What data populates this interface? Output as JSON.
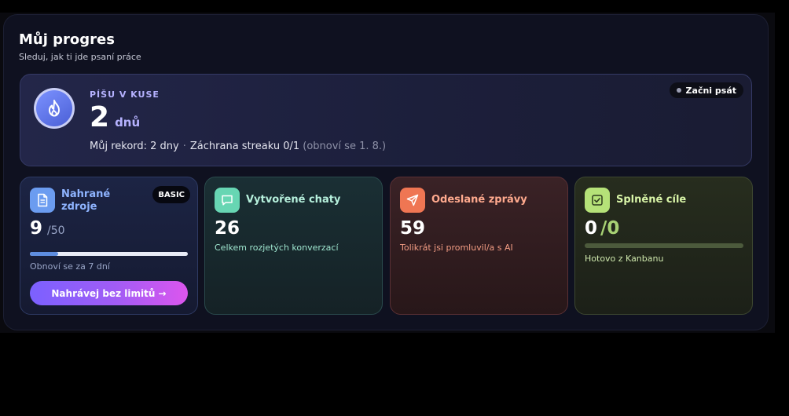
{
  "header": {
    "title": "Můj progres",
    "subtitle": "Sleduj, jak ti jde psaní práce"
  },
  "streak": {
    "label": "PÍŠU V KUSE",
    "value": "2",
    "unit": "dnů",
    "record_text": "Můj rekord: 2 dny",
    "separator": "·",
    "rescue_text": "Záchrana streaku 0/1",
    "rescue_note": "(obnoví se 1. 8.)",
    "start_label": "Začni psát",
    "icon": "flame-icon"
  },
  "cards": {
    "uploads": {
      "title": "Nahrané zdroje",
      "badge": "BASIC",
      "value": "9",
      "limit": "/50",
      "progress_fraction": 0.18,
      "renew_text": "Obnoví se za 7 dní",
      "cta_label": "Nahrávej bez limitů →",
      "icon": "document-icon"
    },
    "chats": {
      "title": "Vytvořené chaty",
      "value": "26",
      "subtitle": "Celkem rozjetých konverzací",
      "icon": "chat-icon"
    },
    "messages": {
      "title": "Odeslané zprávy",
      "value": "59",
      "subtitle": "Tolikrát jsi promluvil/a s AI",
      "icon": "send-icon"
    },
    "goals": {
      "title": "Splněné cíle",
      "value": "0",
      "separator": "/",
      "total": "0",
      "subtitle": "Hotovo z Kanbanu",
      "icon": "checkbox-icon"
    }
  },
  "colors": {
    "accent_blue": "#6b9cf0",
    "accent_teal": "#67d6b3",
    "accent_orange": "#ef7653",
    "accent_green": "#b5e278",
    "cta_gradient_start": "#7b61ff",
    "cta_gradient_end": "#dc56ee"
  }
}
